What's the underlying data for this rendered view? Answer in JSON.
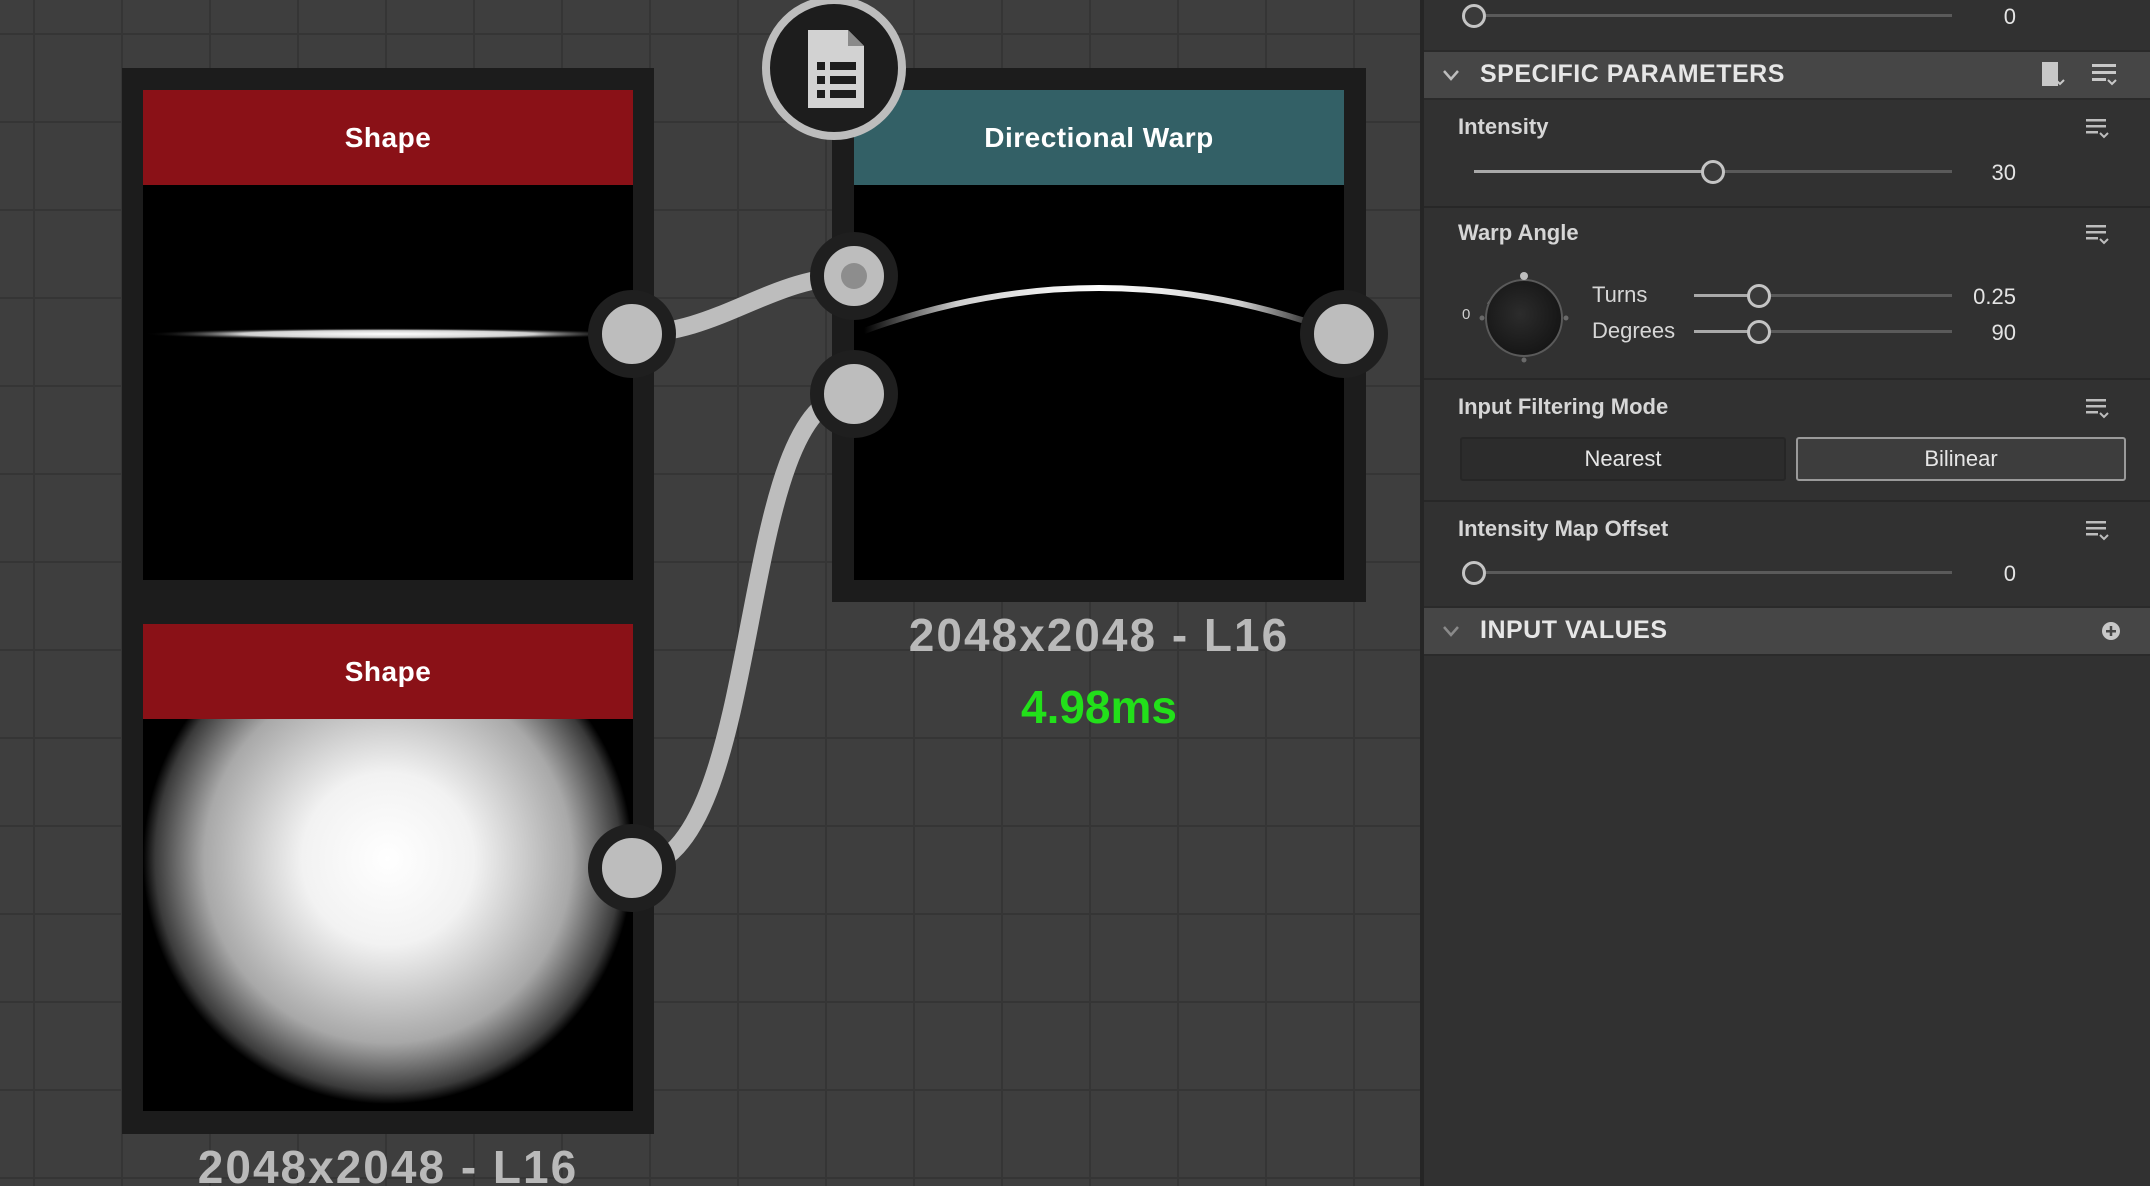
{
  "graph": {
    "nodes": [
      {
        "title": "Shape",
        "header_color": "#8a1117"
      },
      {
        "title": "Shape",
        "header_color": "#8a1117",
        "info": "2048x2048 - L16"
      },
      {
        "title": "Directional Warp",
        "header_color": "#336066",
        "info": "2048x2048 - L16",
        "time": "4.98ms"
      }
    ]
  },
  "panel": {
    "top_slider": {
      "value": "0",
      "fraction": 0
    },
    "specific_parameters": {
      "title": "SPECIFIC PARAMETERS",
      "intensity": {
        "label": "Intensity",
        "value": "30",
        "fraction": 0.5
      },
      "warp_angle": {
        "label": "Warp Angle",
        "dial_zero": "0",
        "turns": {
          "label": "Turns",
          "value": "0.25",
          "fraction": 0.25
        },
        "degrees": {
          "label": "Degrees",
          "value": "90",
          "fraction": 0.25
        }
      },
      "input_filtering_mode": {
        "label": "Input Filtering Mode",
        "options": [
          "Nearest",
          "Bilinear"
        ],
        "selected": "Bilinear"
      },
      "intensity_map_offset": {
        "label": "Intensity Map Offset",
        "value": "0",
        "fraction": 0
      }
    },
    "input_values": {
      "title": "INPUT VALUES"
    }
  },
  "colors": {
    "accent_time": "#22e01a",
    "shape_header": "#8a1117",
    "warp_header": "#336066"
  }
}
